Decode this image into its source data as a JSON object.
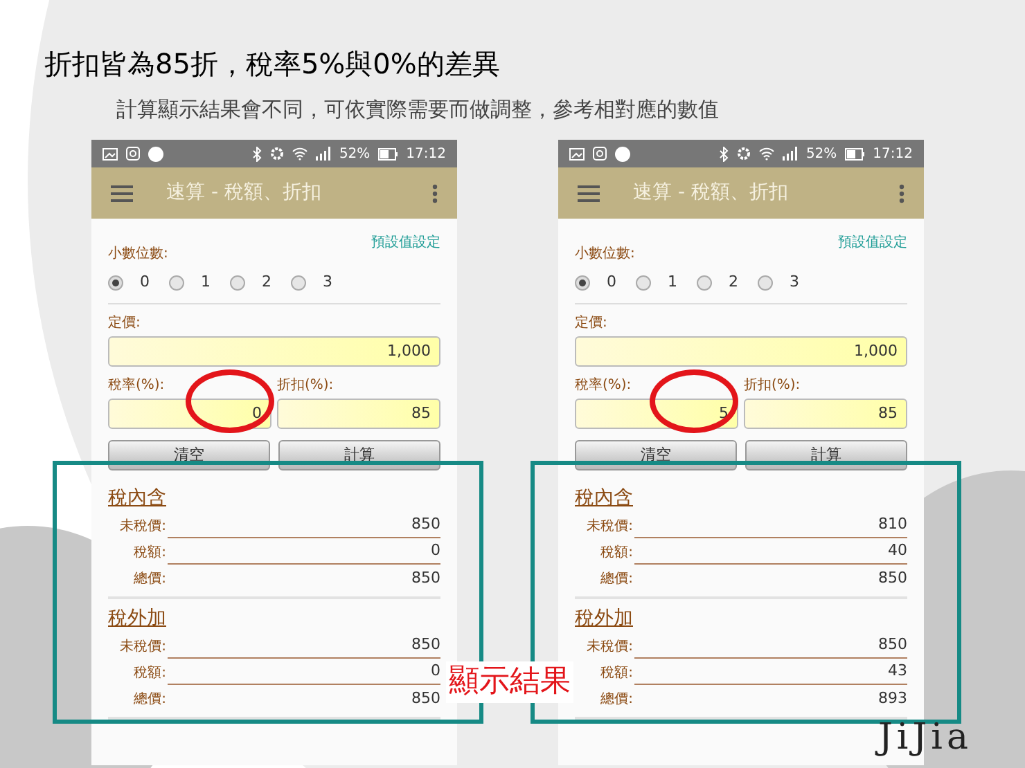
{
  "slide": {
    "title": "折扣皆為85折，稅率5%與0%的差異",
    "subtitle": "計算顯示結果會不同，可依實際需要而做調整，參考相對應的數值"
  },
  "phones": [
    {
      "battery": "52%",
      "time": "17:12",
      "app_title": "速算 - 稅額、折扣",
      "settings_link": "預設值設定",
      "decimal_label": "小數位數:",
      "decimal_options": [
        {
          "label": "0",
          "selected": true
        },
        {
          "label": "1",
          "selected": false
        },
        {
          "label": "2",
          "selected": false
        },
        {
          "label": "3",
          "selected": false
        }
      ],
      "price_label": "定價:",
      "price": "1,000",
      "tax_label": "稅率(%):",
      "tax": "0",
      "discount_label": "折扣(%):",
      "discount": "85",
      "buttons": [
        "清空",
        "計算"
      ],
      "sections": [
        {
          "title": "稅內含",
          "rows": [
            {
              "label": "未稅價:",
              "value": "850"
            },
            {
              "label": "稅額:",
              "value": "0"
            },
            {
              "label": "總價:",
              "value": "850"
            }
          ]
        },
        {
          "title": "稅外加",
          "rows": [
            {
              "label": "未稅價:",
              "value": "850"
            },
            {
              "label": "稅額:",
              "value": "0"
            },
            {
              "label": "總價:",
              "value": "850"
            }
          ]
        }
      ]
    },
    {
      "battery": "52%",
      "time": "17:12",
      "app_title": "速算 - 稅額、折扣",
      "settings_link": "預設值設定",
      "decimal_label": "小數位數:",
      "decimal_options": [
        {
          "label": "0",
          "selected": true
        },
        {
          "label": "1",
          "selected": false
        },
        {
          "label": "2",
          "selected": false
        },
        {
          "label": "3",
          "selected": false
        }
      ],
      "price_label": "定價:",
      "price": "1,000",
      "tax_label": "稅率(%):",
      "tax": "5",
      "discount_label": "折扣(%):",
      "discount": "85",
      "buttons": [
        "清空",
        "計算"
      ],
      "sections": [
        {
          "title": "稅內含",
          "rows": [
            {
              "label": "未稅價:",
              "value": "810"
            },
            {
              "label": "稅額:",
              "value": "40"
            },
            {
              "label": "總價:",
              "value": "850"
            }
          ]
        },
        {
          "title": "稅外加",
          "rows": [
            {
              "label": "未稅價:",
              "value": "850"
            },
            {
              "label": "稅額:",
              "value": "43"
            },
            {
              "label": "總價:",
              "value": "893"
            }
          ]
        }
      ]
    }
  ],
  "callout": "顯示結果",
  "logo": "JiJia"
}
